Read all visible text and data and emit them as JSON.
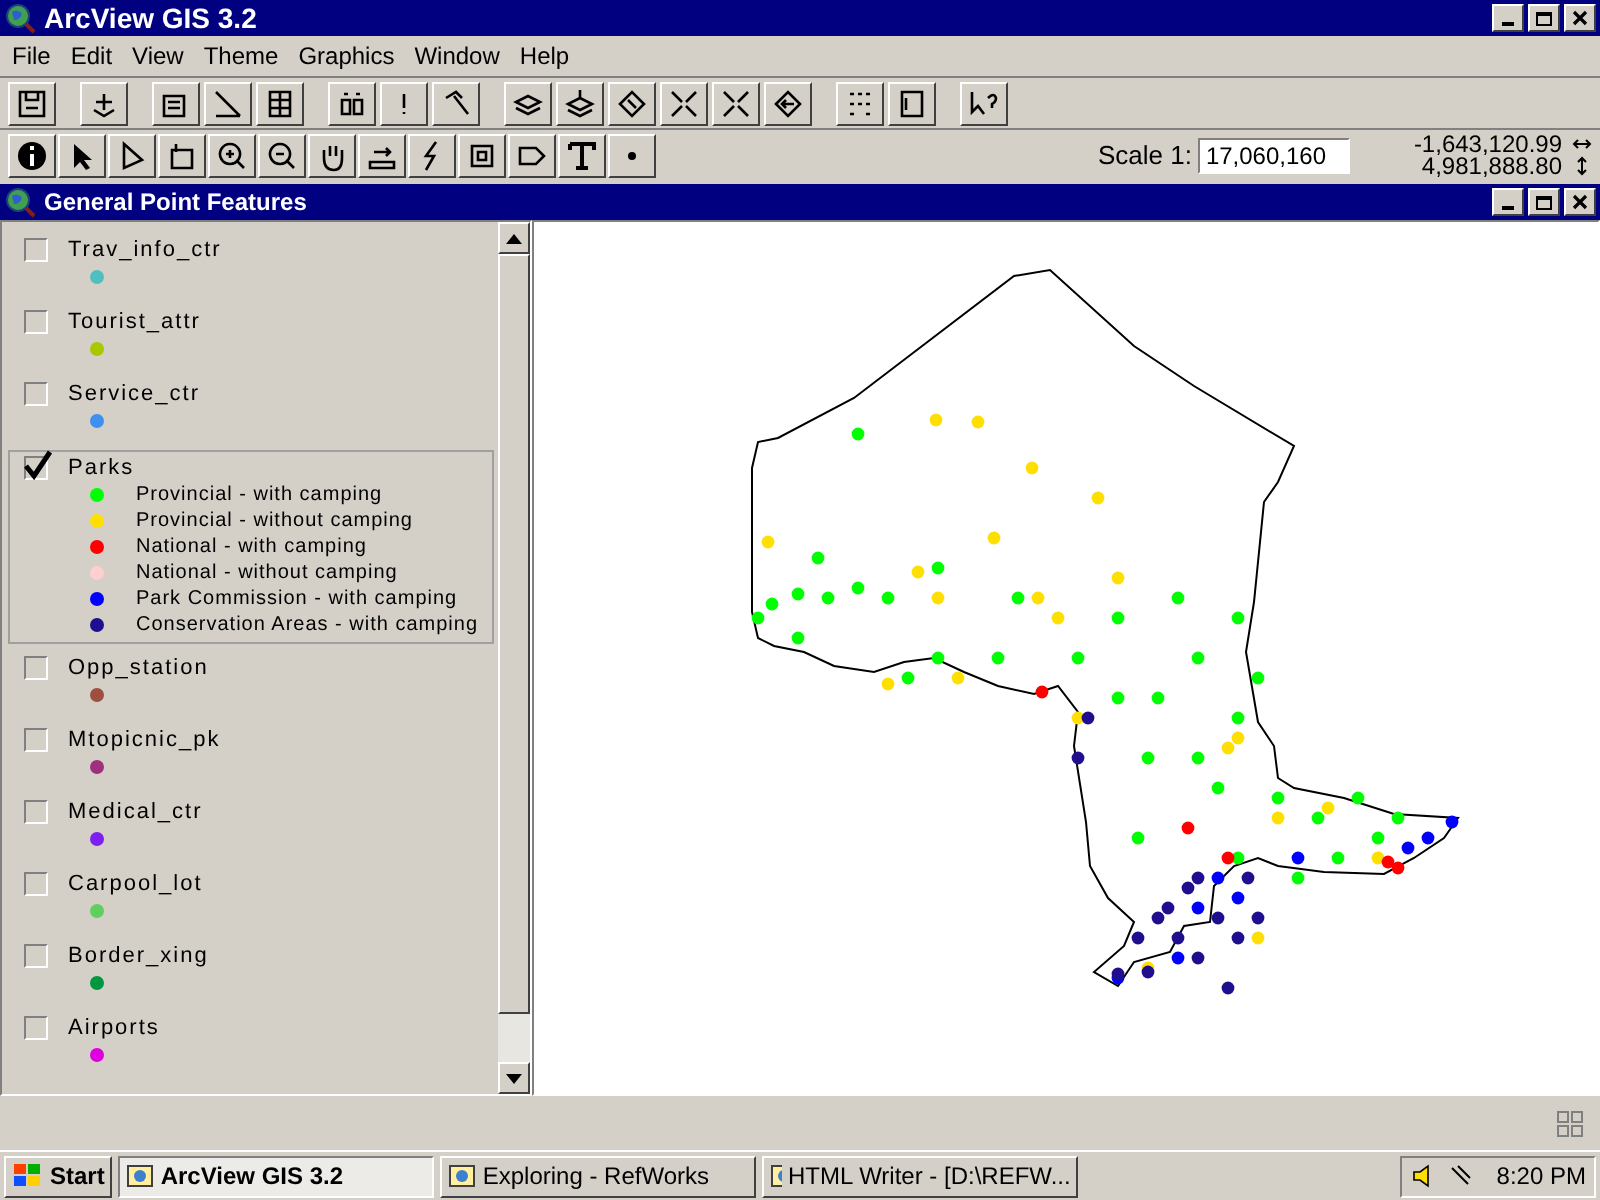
{
  "window": {
    "title": "ArcView GIS 3.2"
  },
  "menu": [
    "File",
    "Edit",
    "View",
    "Theme",
    "Graphics",
    "Window",
    "Help"
  ],
  "toolbar": {
    "scale_label": "Scale 1:",
    "scale_value": "17,060,160",
    "x_coord": "-1,643,120.99",
    "y_coord": "4,981,888.80"
  },
  "view": {
    "title": "General Point Features"
  },
  "legend": [
    {
      "name": "Trav_info_ctr",
      "checked": false,
      "selected": false,
      "symbols": [
        {
          "color": "#4fbfbf"
        }
      ]
    },
    {
      "name": "Tourist_attr",
      "checked": false,
      "selected": false,
      "symbols": [
        {
          "color": "#a8c800"
        }
      ]
    },
    {
      "name": "Service_ctr",
      "checked": false,
      "selected": false,
      "symbols": [
        {
          "color": "#3f8fef"
        }
      ]
    },
    {
      "name": "Parks",
      "checked": true,
      "selected": true,
      "symbols": [
        {
          "label": "Provincial - with camping",
          "color": "#00ff00"
        },
        {
          "label": "Provincial - without camping",
          "color": "#ffdf00"
        },
        {
          "label": "National - with camping",
          "color": "#ff0000"
        },
        {
          "label": "National - without camping",
          "color": "#ffcfcf"
        },
        {
          "label": "Park Commission - with camping",
          "color": "#0000ff"
        },
        {
          "label": "Conservation Areas - with camping",
          "color": "#1f0f8f"
        }
      ]
    },
    {
      "name": "Opp_station",
      "checked": false,
      "selected": false,
      "symbols": [
        {
          "color": "#9f4f3f"
        }
      ]
    },
    {
      "name": "Mtopicnic_pk",
      "checked": false,
      "selected": false,
      "symbols": [
        {
          "color": "#9f2f7f"
        }
      ]
    },
    {
      "name": "Medical_ctr",
      "checked": false,
      "selected": false,
      "symbols": [
        {
          "color": "#7f1fef"
        }
      ]
    },
    {
      "name": "Carpool_lot",
      "checked": false,
      "selected": false,
      "symbols": [
        {
          "color": "#5fcf5f"
        }
      ]
    },
    {
      "name": "Border_xing",
      "checked": false,
      "selected": false,
      "symbols": [
        {
          "color": "#00973f"
        }
      ]
    },
    {
      "name": "Airports",
      "checked": false,
      "selected": false,
      "symbols": [
        {
          "color": "#df00df"
        }
      ]
    }
  ],
  "taskbar": {
    "start": "Start",
    "tasks": [
      {
        "label": "ArcView GIS 3.2",
        "selected": true
      },
      {
        "label": "Exploring - RefWorks",
        "selected": false
      },
      {
        "label": "HTML Writer - [D:\\REFW...",
        "selected": false
      }
    ],
    "clock": "8:20 PM"
  }
}
